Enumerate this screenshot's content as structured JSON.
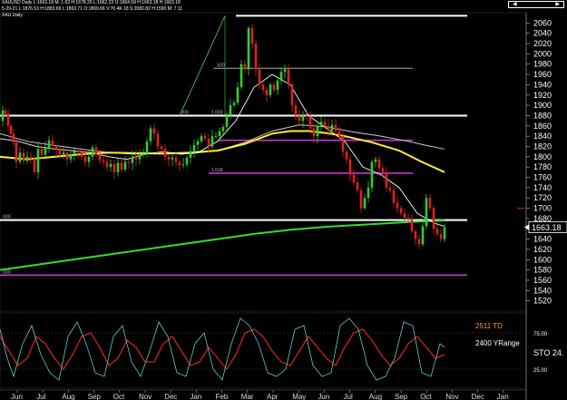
{
  "window": {
    "info_lines": [
      "XAUUSD Daily  L:1663.18  M:  1.63  H:1678.20  L:1662.23  O:1664.59  H:1663.18  H:1663.18",
      "5-29-21  L:1876.53  H:1883.69  L:1863.71  O:1869.66  V:70.4K  18  S:2082.82  H:1590  M:  7.11",
      "XAU Daily"
    ]
  },
  "chart_data": [
    {
      "type": "candlestick",
      "title": "",
      "xlabel": "",
      "ylabel": "",
      "ylim": [
        1500,
        2080
      ],
      "y_ticks": [
        1520,
        1540,
        1560,
        1580,
        1600,
        1620,
        1640,
        1660,
        1680,
        1700,
        1720,
        1740,
        1760,
        1780,
        1800,
        1820,
        1840,
        1860,
        1880,
        1900,
        1920,
        1940,
        1960,
        1980,
        2000,
        2020,
        2040,
        2060
      ],
      "x_ticks": [
        "Jun",
        "Jul",
        "Aug",
        "Sep",
        "Oct",
        "Nov",
        "Dec",
        "Jan",
        "Feb",
        "Mar",
        "Apr",
        "May",
        "Jun",
        "Jul",
        "Aug",
        "Sep",
        "Oct",
        "Nov",
        "Dec",
        "Jan"
      ],
      "last_price": "1663.18",
      "right_marker": "1700",
      "horizontal_levels": [
        {
          "value": 1880,
          "color": "#ffffff"
        },
        {
          "value": 1832,
          "color": "#cc33cc"
        },
        {
          "value": 1768,
          "color": "#cc33cc"
        },
        {
          "value": 1677,
          "color": "#ffffff"
        },
        {
          "value": 1570,
          "color": "#cc33cc"
        },
        {
          "value": 1972,
          "color": "#aaaaaa"
        },
        {
          "value": 2074,
          "color": "#ffffff"
        }
      ],
      "fib_labels": [
        "1.000",
        ".500",
        ".000",
        "1.618",
        ".000",
        ".000"
      ],
      "price_path": [
        [
          0,
          1870
        ],
        [
          3,
          1890
        ],
        [
          6,
          1884
        ],
        [
          9,
          1860
        ],
        [
          12,
          1845
        ],
        [
          15,
          1828
        ],
        [
          18,
          1790
        ],
        [
          22,
          1808
        ],
        [
          26,
          1792
        ],
        [
          30,
          1800
        ],
        [
          34,
          1796
        ],
        [
          38,
          1770
        ],
        [
          42,
          1815
        ],
        [
          46,
          1804
        ],
        [
          50,
          1817
        ],
        [
          54,
          1832
        ],
        [
          58,
          1822
        ],
        [
          62,
          1814
        ],
        [
          66,
          1804
        ],
        [
          70,
          1808
        ],
        [
          74,
          1795
        ],
        [
          78,
          1805
        ],
        [
          82,
          1811
        ],
        [
          86,
          1809
        ],
        [
          90,
          1800
        ],
        [
          94,
          1790
        ],
        [
          98,
          1800
        ],
        [
          102,
          1818
        ],
        [
          106,
          1805
        ],
        [
          110,
          1793
        ],
        [
          114,
          1790
        ],
        [
          118,
          1780
        ],
        [
          122,
          1786
        ],
        [
          126,
          1770
        ],
        [
          130,
          1788
        ],
        [
          134,
          1775
        ],
        [
          138,
          1790
        ],
        [
          142,
          1788
        ],
        [
          146,
          1800
        ],
        [
          150,
          1795
        ],
        [
          154,
          1803
        ],
        [
          158,
          1806
        ],
        [
          162,
          1830
        ],
        [
          166,
          1855
        ],
        [
          170,
          1845
        ],
        [
          174,
          1820
        ],
        [
          178,
          1815
        ],
        [
          182,
          1800
        ],
        [
          186,
          1795
        ],
        [
          190,
          1798
        ],
        [
          194,
          1790
        ],
        [
          198,
          1784
        ],
        [
          202,
          1785
        ],
        [
          206,
          1798
        ],
        [
          210,
          1811
        ],
        [
          214,
          1823
        ],
        [
          218,
          1830
        ],
        [
          222,
          1840
        ],
        [
          226,
          1835
        ],
        [
          230,
          1820
        ],
        [
          234,
          1840
        ],
        [
          238,
          1840
        ],
        [
          242,
          1850
        ],
        [
          246,
          1858
        ],
        [
          250,
          1880
        ],
        [
          254,
          1900
        ],
        [
          258,
          1905
        ],
        [
          262,
          1935
        ],
        [
          266,
          1980
        ],
        [
          270,
          1970
        ],
        [
          274,
          2050
        ],
        [
          278,
          2020
        ],
        [
          282,
          1970
        ],
        [
          286,
          1940
        ],
        [
          290,
          1930
        ],
        [
          294,
          1920
        ],
        [
          298,
          1940
        ],
        [
          302,
          1930
        ],
        [
          306,
          1948
        ],
        [
          310,
          1965
        ],
        [
          314,
          1970
        ],
        [
          318,
          1940
        ],
        [
          322,
          1900
        ],
        [
          326,
          1880
        ],
        [
          330,
          1870
        ],
        [
          334,
          1880
        ],
        [
          338,
          1878
        ],
        [
          342,
          1855
        ],
        [
          346,
          1840
        ],
        [
          350,
          1860
        ],
        [
          354,
          1868
        ],
        [
          358,
          1860
        ],
        [
          362,
          1850
        ],
        [
          366,
          1862
        ],
        [
          370,
          1850
        ],
        [
          374,
          1840
        ],
        [
          378,
          1810
        ],
        [
          382,
          1795
        ],
        [
          386,
          1765
        ],
        [
          390,
          1750
        ],
        [
          394,
          1735
        ],
        [
          398,
          1700
        ],
        [
          402,
          1720
        ],
        [
          406,
          1740
        ],
        [
          410,
          1790
        ],
        [
          414,
          1795
        ],
        [
          418,
          1778
        ],
        [
          422,
          1770
        ],
        [
          426,
          1740
        ],
        [
          430,
          1735
        ],
        [
          434,
          1710
        ],
        [
          438,
          1700
        ],
        [
          442,
          1690
        ],
        [
          446,
          1682
        ],
        [
          450,
          1680
        ],
        [
          454,
          1655
        ],
        [
          458,
          1640
        ],
        [
          462,
          1630
        ],
        [
          466,
          1665
        ],
        [
          470,
          1720
        ],
        [
          474,
          1700
        ],
        [
          478,
          1660
        ],
        [
          482,
          1650
        ],
        [
          486,
          1640
        ],
        [
          490,
          1663
        ]
      ],
      "ma_fast_white": [
        [
          0,
          1835
        ],
        [
          20,
          1830
        ],
        [
          40,
          1820
        ],
        [
          60,
          1815
        ],
        [
          80,
          1812
        ],
        [
          100,
          1808
        ],
        [
          120,
          1800
        ],
        [
          140,
          1795
        ],
        [
          160,
          1805
        ],
        [
          180,
          1810
        ],
        [
          200,
          1805
        ],
        [
          220,
          1810
        ],
        [
          240,
          1830
        ],
        [
          260,
          1870
        ],
        [
          280,
          1935
        ],
        [
          300,
          1960
        ],
        [
          320,
          1940
        ],
        [
          340,
          1880
        ],
        [
          360,
          1855
        ],
        [
          380,
          1830
        ],
        [
          400,
          1780
        ],
        [
          420,
          1765
        ],
        [
          440,
          1740
        ],
        [
          460,
          1690
        ],
        [
          480,
          1670
        ],
        [
          490,
          1665
        ]
      ],
      "ma_mid_white": [
        [
          0,
          1845
        ],
        [
          30,
          1830
        ],
        [
          60,
          1822
        ],
        [
          90,
          1815
        ],
        [
          120,
          1808
        ],
        [
          150,
          1805
        ],
        [
          180,
          1807
        ],
        [
          210,
          1806
        ],
        [
          240,
          1812
        ],
        [
          270,
          1828
        ],
        [
          300,
          1850
        ],
        [
          330,
          1862
        ],
        [
          360,
          1858
        ],
        [
          390,
          1848
        ],
        [
          420,
          1840
        ],
        [
          450,
          1830
        ],
        [
          470,
          1822
        ],
        [
          490,
          1815
        ]
      ],
      "ma_yellow": [
        [
          0,
          1800
        ],
        [
          30,
          1795
        ],
        [
          60,
          1800
        ],
        [
          90,
          1805
        ],
        [
          120,
          1808
        ],
        [
          150,
          1807
        ],
        [
          180,
          1806
        ],
        [
          210,
          1808
        ],
        [
          240,
          1812
        ],
        [
          270,
          1825
        ],
        [
          300,
          1845
        ],
        [
          320,
          1850
        ],
        [
          340,
          1850
        ],
        [
          360,
          1846
        ],
        [
          380,
          1840
        ],
        [
          410,
          1828
        ],
        [
          440,
          1812
        ],
        [
          465,
          1790
        ],
        [
          490,
          1770
        ]
      ],
      "ma_green": [
        [
          0,
          1580
        ],
        [
          40,
          1590
        ],
        [
          80,
          1600
        ],
        [
          120,
          1610
        ],
        [
          160,
          1620
        ],
        [
          200,
          1630
        ],
        [
          240,
          1640
        ],
        [
          280,
          1650
        ],
        [
          320,
          1658
        ],
        [
          360,
          1664
        ],
        [
          400,
          1668
        ],
        [
          440,
          1672
        ],
        [
          470,
          1675
        ],
        [
          490,
          1676
        ]
      ]
    },
    {
      "type": "line",
      "title": "",
      "ylim": [
        0,
        100
      ],
      "y_ticks": [
        25,
        75
      ],
      "labels": [
        "2511 TD",
        "2400 YRange",
        "STO  24."
      ],
      "series": [
        {
          "color": "#cc2222",
          "values": [
            [
              0,
              70
            ],
            [
              10,
              50
            ],
            [
              20,
              30
            ],
            [
              30,
              40
            ],
            [
              40,
              70
            ],
            [
              50,
              60
            ],
            [
              60,
              40
            ],
            [
              70,
              25
            ],
            [
              80,
              45
            ],
            [
              90,
              70
            ],
            [
              100,
              75
            ],
            [
              110,
              55
            ],
            [
              120,
              30
            ],
            [
              130,
              40
            ],
            [
              140,
              65
            ],
            [
              150,
              55
            ],
            [
              160,
              35
            ],
            [
              170,
              35
            ],
            [
              180,
              60
            ],
            [
              190,
              70
            ],
            [
              200,
              50
            ],
            [
              210,
              30
            ],
            [
              220,
              35
            ],
            [
              230,
              55
            ],
            [
              240,
              40
            ],
            [
              250,
              25
            ],
            [
              260,
              45
            ],
            [
              270,
              75
            ],
            [
              280,
              80
            ],
            [
              290,
              70
            ],
            [
              300,
              50
            ],
            [
              310,
              35
            ],
            [
              320,
              30
            ],
            [
              330,
              50
            ],
            [
              340,
              70
            ],
            [
              350,
              55
            ],
            [
              360,
              40
            ],
            [
              370,
              30
            ],
            [
              380,
              55
            ],
            [
              390,
              75
            ],
            [
              400,
              80
            ],
            [
              410,
              65
            ],
            [
              420,
              45
            ],
            [
              430,
              30
            ],
            [
              440,
              40
            ],
            [
              450,
              60
            ],
            [
              460,
              70
            ],
            [
              470,
              55
            ],
            [
              480,
              40
            ],
            [
              490,
              45
            ]
          ]
        },
        {
          "color": "#66cccc",
          "values": [
            [
              0,
              80
            ],
            [
              8,
              40
            ],
            [
              15,
              15
            ],
            [
              25,
              60
            ],
            [
              35,
              85
            ],
            [
              45,
              45
            ],
            [
              55,
              20
            ],
            [
              65,
              10
            ],
            [
              75,
              70
            ],
            [
              85,
              90
            ],
            [
              95,
              60
            ],
            [
              105,
              20
            ],
            [
              115,
              15
            ],
            [
              125,
              70
            ],
            [
              135,
              85
            ],
            [
              145,
              35
            ],
            [
              155,
              15
            ],
            [
              165,
              50
            ],
            [
              175,
              90
            ],
            [
              185,
              70
            ],
            [
              195,
              20
            ],
            [
              205,
              15
            ],
            [
              215,
              60
            ],
            [
              225,
              75
            ],
            [
              235,
              25
            ],
            [
              245,
              10
            ],
            [
              255,
              60
            ],
            [
              265,
              95
            ],
            [
              275,
              85
            ],
            [
              285,
              60
            ],
            [
              295,
              20
            ],
            [
              305,
              15
            ],
            [
              315,
              25
            ],
            [
              325,
              80
            ],
            [
              335,
              85
            ],
            [
              345,
              30
            ],
            [
              355,
              15
            ],
            [
              365,
              20
            ],
            [
              375,
              85
            ],
            [
              385,
              95
            ],
            [
              395,
              80
            ],
            [
              405,
              30
            ],
            [
              415,
              10
            ],
            [
              425,
              15
            ],
            [
              435,
              40
            ],
            [
              445,
              90
            ],
            [
              455,
              85
            ],
            [
              465,
              20
            ],
            [
              475,
              15
            ],
            [
              485,
              60
            ],
            [
              490,
              55
            ]
          ]
        }
      ]
    }
  ]
}
